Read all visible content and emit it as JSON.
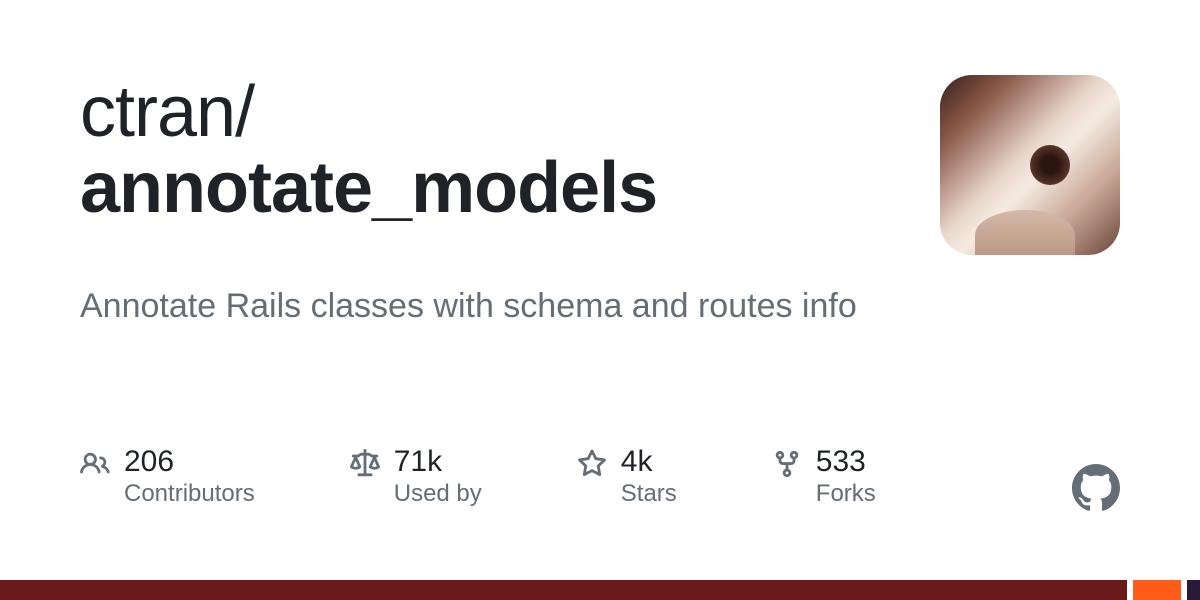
{
  "repo": {
    "owner": "ctran",
    "name": "annotate_models",
    "description": "Annotate Rails classes with schema and routes info"
  },
  "stats": {
    "contributors": {
      "value": "206",
      "label": "Contributors"
    },
    "used_by": {
      "value": "71k",
      "label": "Used by"
    },
    "stars": {
      "value": "4k",
      "label": "Stars"
    },
    "forks": {
      "value": "533",
      "label": "Forks"
    }
  }
}
